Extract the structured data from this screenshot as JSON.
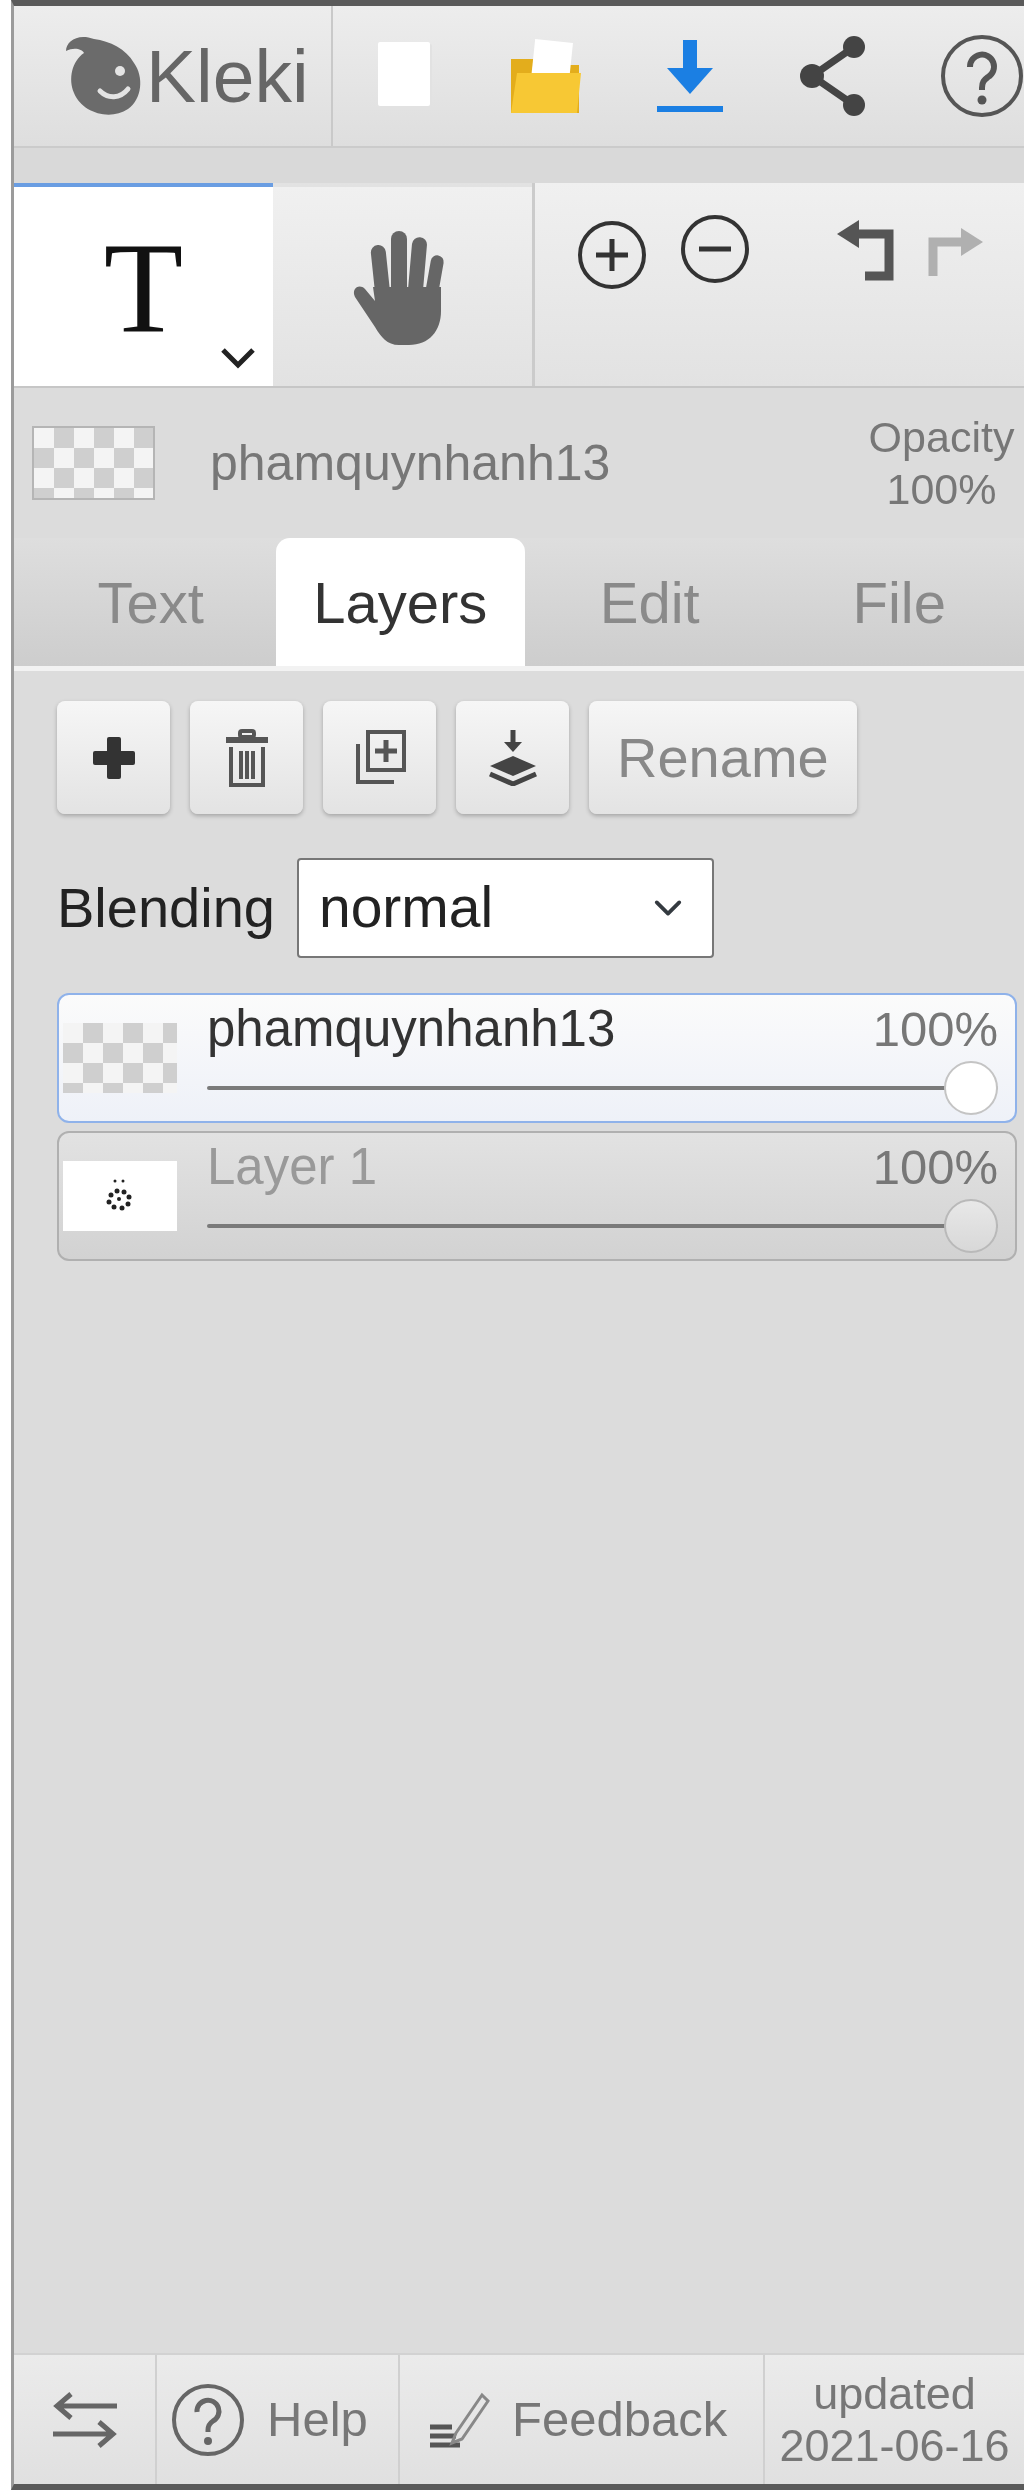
{
  "header": {
    "logo_text": "Kleki"
  },
  "tools": [
    {
      "kind": "text",
      "label": "T",
      "selected": true
    },
    {
      "kind": "hand",
      "selected": false
    }
  ],
  "history": {
    "undo": {
      "disabled": false
    },
    "redo": {
      "disabled": true
    }
  },
  "current_layer": {
    "name": "phamquynhanh13",
    "opacity_label": "Opacity",
    "opacity_value": "100%"
  },
  "tabs": [
    {
      "label": "Text",
      "selected": false
    },
    {
      "label": "Layers",
      "selected": true
    },
    {
      "label": "Edit",
      "selected": false
    },
    {
      "label": "File",
      "selected": false
    }
  ],
  "layer_actions": {
    "rename_label": "Rename"
  },
  "blending": {
    "label": "Blending",
    "value": "normal"
  },
  "layers": [
    {
      "kind": "empty",
      "name": "phamquynhanh13",
      "opacity": "100%",
      "level": 1,
      "selected": true
    },
    {
      "kind": "sketch",
      "name": "Layer 1",
      "opacity": "100%",
      "level": 1,
      "selected": false
    }
  ],
  "footer": {
    "help_label": "Help",
    "feedback_label": "Feedback",
    "updated_label": "updated",
    "updated_date": "2021-06-16"
  }
}
